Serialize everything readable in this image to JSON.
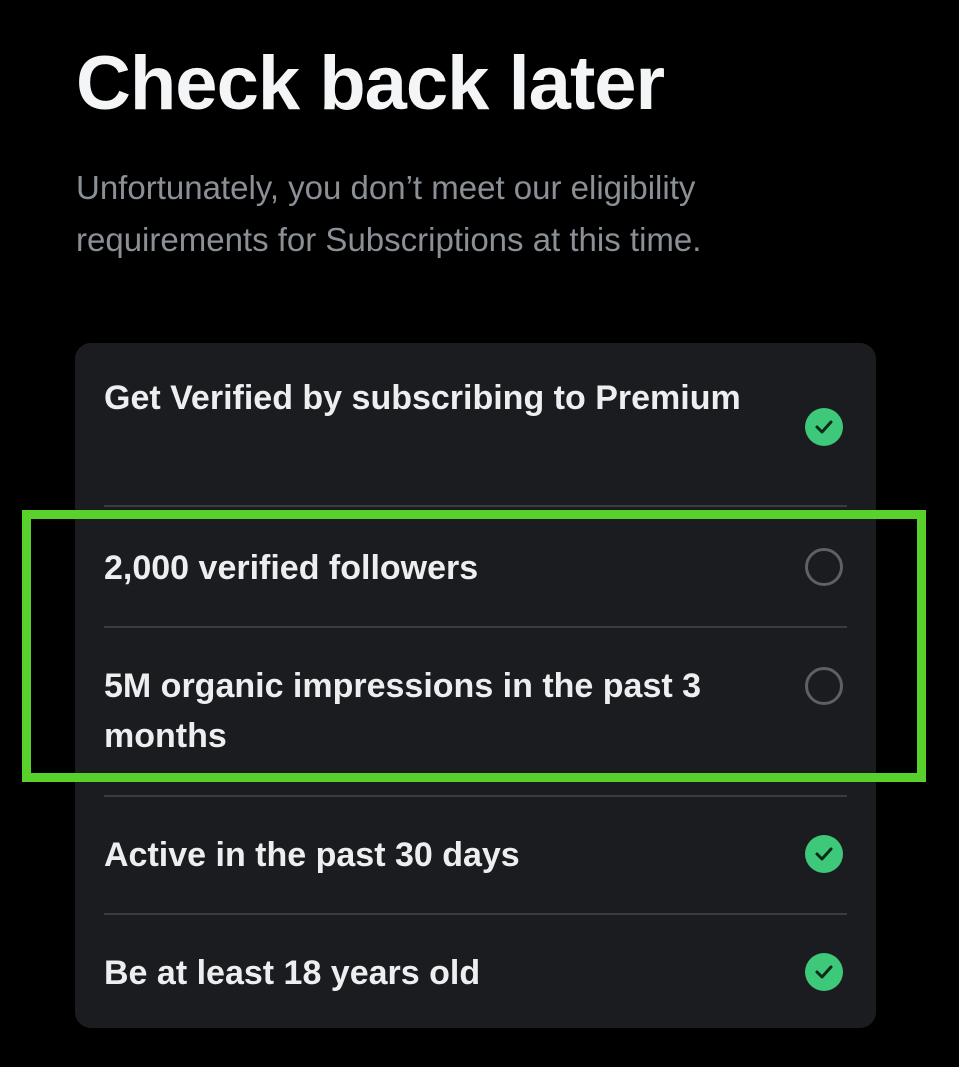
{
  "header": {
    "title": "Check back later",
    "subtitle": "Unfortunately, you don’t meet our eligibility requirements for Subscriptions at this time."
  },
  "requirements": [
    {
      "label": "Get Verified by subscribing to Premium",
      "met": true,
      "icon": "check-circle-icon"
    },
    {
      "label": "2,000 verified followers",
      "met": false,
      "icon": "empty-circle-icon"
    },
    {
      "label": "5M organic impressions in the past 3 months",
      "met": false,
      "icon": "empty-circle-icon"
    },
    {
      "label": "Active in the past 30 days",
      "met": true,
      "icon": "check-circle-icon"
    },
    {
      "label": "Be at least 18 years old",
      "met": true,
      "icon": "check-circle-icon"
    }
  ],
  "colors": {
    "background": "#000000",
    "card": "#1b1c20",
    "check": "#3ec97a",
    "highlight": "#58d12c",
    "subtitle": "#8b9096"
  }
}
